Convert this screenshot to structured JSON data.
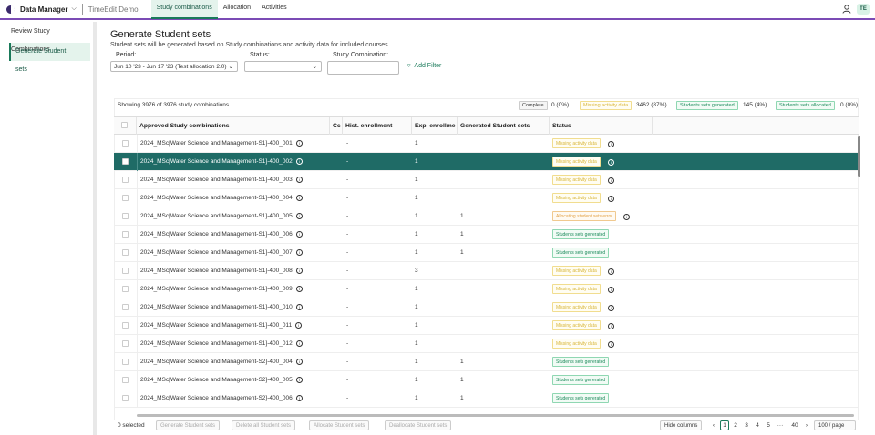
{
  "topbar": {
    "app": "Data Manager",
    "env": "TimeEdit Demo",
    "tabs": [
      "Study combinations",
      "Allocation",
      "Activities"
    ],
    "badge": "TE"
  },
  "sidebar": [
    "Review Study Combinations",
    "Generate Student sets"
  ],
  "page": {
    "title": "Generate Student sets",
    "subtitle": "Student sets will be generated based on Study combinations and activity data for included courses"
  },
  "filters": {
    "period_label": "Period:",
    "period_value": "Jun 10 '23 - Jun 17 '23 (Test allocation 2.0)",
    "status_label": "Status:",
    "status_value": "",
    "combo_label": "Study Combination:",
    "combo_value": "",
    "add_filter": "Add Filter"
  },
  "summary": {
    "showing": "Showing 3976 of 3976 study combinations",
    "complete_label": "Complete",
    "complete_count": "0 (0%)",
    "missing_label": "Missing activity data",
    "missing_count": "3462 (87%)",
    "generated_label": "Students sets generated",
    "generated_count": "145 (4%)",
    "allocated_label": "Students sets allocated",
    "allocated_count": "0 (0%)"
  },
  "columns": [
    "Approved Study combinations",
    "Cc",
    "Hist. enrollment",
    "Exp. enrollme",
    "Generated Student sets",
    "Status"
  ],
  "rows": [
    {
      "name": "2024_MSc[Water Science and Management-S1]-400_001",
      "hist": "-",
      "exp": "1",
      "gen": "",
      "status": "Missing activity data",
      "kind": "yel",
      "info": true
    },
    {
      "name": "2024_MSc[Water Science and Management-S1]-400_002",
      "hist": "-",
      "exp": "1",
      "gen": "",
      "status": "Missing activity data",
      "kind": "yel",
      "info": true,
      "hl": true
    },
    {
      "name": "2024_MSc[Water Science and Management-S1]-400_003",
      "hist": "-",
      "exp": "1",
      "gen": "",
      "status": "Missing activity data",
      "kind": "yel",
      "info": true
    },
    {
      "name": "2024_MSc[Water Science and Management-S1]-400_004",
      "hist": "-",
      "exp": "1",
      "gen": "",
      "status": "Missing activity data",
      "kind": "yel",
      "info": true
    },
    {
      "name": "2024_MSc[Water Science and Management-S1]-400_005",
      "hist": "-",
      "exp": "1",
      "gen": "1",
      "status": "Allocating student sets error",
      "kind": "org",
      "info": true
    },
    {
      "name": "2024_MSc[Water Science and Management-S1]-400_006",
      "hist": "-",
      "exp": "1",
      "gen": "1",
      "status": "Students sets generated",
      "kind": "grn",
      "info": false
    },
    {
      "name": "2024_MSc[Water Science and Management-S1]-400_007",
      "hist": "-",
      "exp": "1",
      "gen": "1",
      "status": "Students sets generated",
      "kind": "grn",
      "info": false
    },
    {
      "name": "2024_MSc[Water Science and Management-S1]-400_008",
      "hist": "-",
      "exp": "3",
      "gen": "",
      "status": "Missing activity data",
      "kind": "yel",
      "info": true
    },
    {
      "name": "2024_MSc[Water Science and Management-S1]-400_009",
      "hist": "-",
      "exp": "1",
      "gen": "",
      "status": "Missing activity data",
      "kind": "yel",
      "info": true
    },
    {
      "name": "2024_MSc[Water Science and Management-S1]-400_010",
      "hist": "-",
      "exp": "1",
      "gen": "",
      "status": "Missing activity data",
      "kind": "yel",
      "info": true
    },
    {
      "name": "2024_MSc[Water Science and Management-S1]-400_011",
      "hist": "-",
      "exp": "1",
      "gen": "",
      "status": "Missing activity data",
      "kind": "yel",
      "info": true
    },
    {
      "name": "2024_MSc[Water Science and Management-S1]-400_012",
      "hist": "-",
      "exp": "1",
      "gen": "",
      "status": "Missing activity data",
      "kind": "yel",
      "info": true
    },
    {
      "name": "2024_MSc[Water Science and Management-S2]-400_004",
      "hist": "-",
      "exp": "1",
      "gen": "1",
      "status": "Students sets generated",
      "kind": "grn",
      "info": false
    },
    {
      "name": "2024_MSc[Water Science and Management-S2]-400_005",
      "hist": "-",
      "exp": "1",
      "gen": "1",
      "status": "Students sets generated",
      "kind": "grn",
      "info": false
    },
    {
      "name": "2024_MSc[Water Science and Management-S2]-400_006",
      "hist": "-",
      "exp": "1",
      "gen": "1",
      "status": "Students sets generated",
      "kind": "grn",
      "info": false
    }
  ],
  "footer": {
    "selected": "0 selected",
    "buttons": [
      "Generate Student sets",
      "Delete all Student sets",
      "Allocate Student sets",
      "Deallocate Student sets"
    ],
    "hide_columns": "Hide columns",
    "pages": [
      "1",
      "2",
      "3",
      "4",
      "5",
      "···",
      "40"
    ],
    "per_page": "100 / page"
  }
}
